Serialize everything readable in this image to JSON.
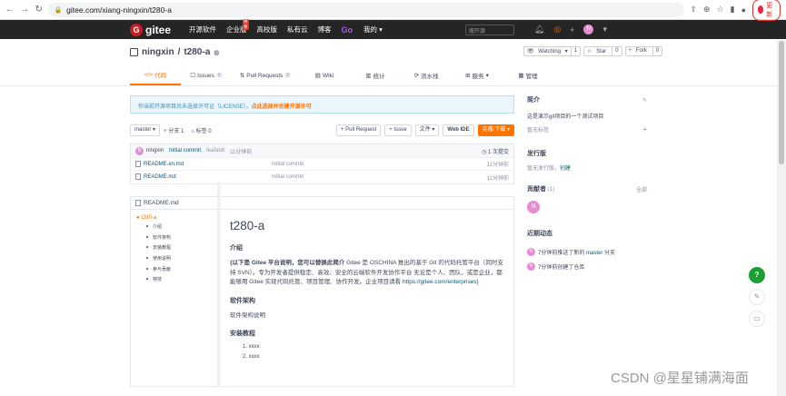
{
  "browser": {
    "url": "gitee.com/xiang-ningxin/t280-a",
    "update_label": "更新"
  },
  "topnav": {
    "logo_text": "gitee",
    "logo_letter": "G",
    "items": [
      "开源软件",
      "企业版",
      "高校版",
      "私有云",
      "博客"
    ],
    "hot_badge": "特惠",
    "go_label": "Go",
    "mine_label": "我的",
    "search_placeholder": "搜开源",
    "avatar_letter": "N"
  },
  "repo": {
    "owner": "ningxin",
    "separator": "/",
    "name": "t280-a",
    "watch_label": "Watching",
    "watch_count": "1",
    "star_label": "Star",
    "star_count": "0",
    "fork_label": "Fork",
    "fork_count": "0"
  },
  "tabs": [
    {
      "label": "代码",
      "icon": "</>"
    },
    {
      "label": "Issues",
      "icon": "☐",
      "count": "0"
    },
    {
      "label": "Pull Requests",
      "icon": "⇅",
      "count": "0"
    },
    {
      "label": "Wiki",
      "icon": "▤"
    },
    {
      "label": "统计",
      "icon": "▥"
    },
    {
      "label": "流水线",
      "icon": "⟳"
    },
    {
      "label": "服务",
      "icon": "⊞"
    },
    {
      "label": "管理",
      "icon": "▦"
    }
  ],
  "notice": {
    "text": "你当前开源项目尚未选择许可证（LICENSE），",
    "link": "点此选择并创建开源许可"
  },
  "toolbar": {
    "branch": "master",
    "branches": "分支 1",
    "tags": "标签 0",
    "pull_request": "+ Pull Request",
    "issue": "+ Issue",
    "file": "文件",
    "webide": "Web IDE",
    "clone": "克隆/下载"
  },
  "commit": {
    "avatar_letter": "N",
    "author": "ningxin",
    "message": "Initial commit",
    "hash": "feafab8",
    "time": "11分钟前",
    "count": "1 次提交"
  },
  "files": [
    {
      "name": "README.en.md",
      "message": "Initial commit",
      "time": "11分钟前"
    },
    {
      "name": "README.md",
      "message": "Initial commit",
      "time": "11分钟前"
    }
  ],
  "readme": {
    "header": "README.md",
    "toc_title": "t280-a",
    "toc_items": [
      "介绍",
      "软件架构",
      "安装教程",
      "使用说明",
      "参与贡献",
      "特技"
    ],
    "title": "t280-a",
    "intro_heading": "介绍",
    "intro_bold": "{以下是 Gitee 平台说明，您可以替换此简介",
    "intro_text": " Gitee 是 OSCHINA 推出的基于 Git 的代码托管平台（同时支持 SVN）。专为开发者提供稳定、高效、安全的云端软件开发协作平台 无论是个人、团队、或是企业，都能够用 Gitee 实现代码托管、项目管理、协作开发。企业项目请看 ",
    "intro_link": "https://gitee.com/enterprises",
    "intro_end": "}",
    "arch_heading": "软件架构",
    "arch_text": "软件架构说明",
    "install_heading": "安装教程",
    "install_items": [
      "1. xxxx",
      "2. xxxx"
    ]
  },
  "sidebar": {
    "intro_title": "简介",
    "intro_text": "这是演示git项目的一个测试项目",
    "no_tags": "暂无标签",
    "release_title": "发行版",
    "release_text": "暂无发行版，",
    "release_link": "创建",
    "contrib_title": "贡献者",
    "contrib_count": "(1)",
    "contrib_all": "全部",
    "contrib_letter": "N",
    "activity_title": "近期动态",
    "activities": [
      {
        "letter": "N",
        "pre": "7分钟前推送了新的 ",
        "link": "master",
        "post": " 分支"
      },
      {
        "letter": "N",
        "pre": "7分钟前创建了仓库",
        "link": "",
        "post": ""
      }
    ]
  },
  "watermark": "CSDN @星星铺满海面",
  "colors": {
    "brand": "#c71d23",
    "accent": "#fe7300",
    "link": "#005980"
  }
}
